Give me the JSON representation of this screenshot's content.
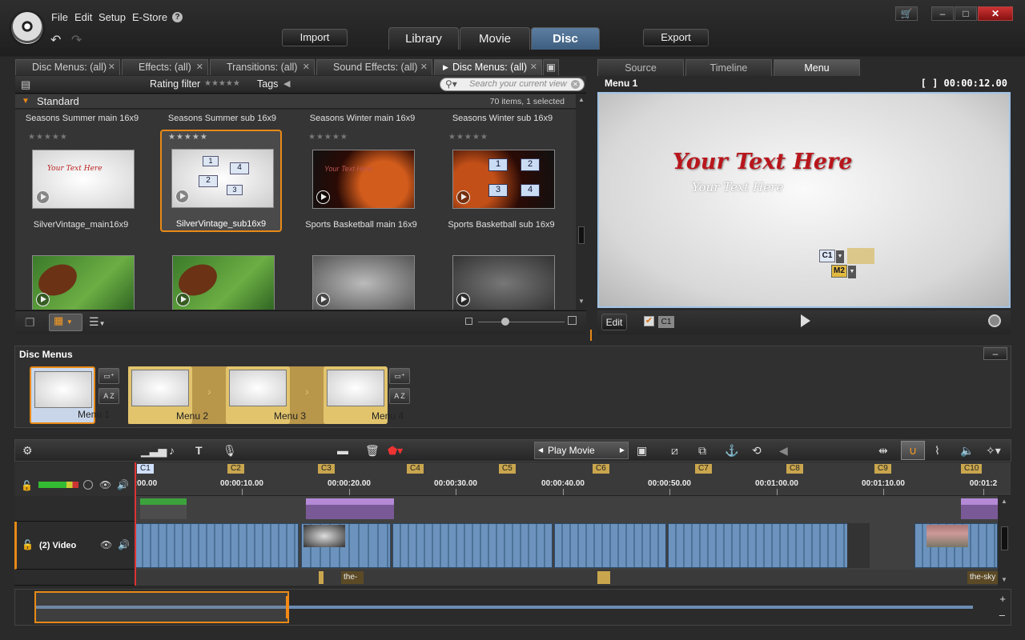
{
  "menubar": {
    "file": "File",
    "edit": "Edit",
    "setup": "Setup",
    "estore": "E-Store",
    "help": "?"
  },
  "header": {
    "import": "Import",
    "export": "Export",
    "tabs": [
      "Library",
      "Movie",
      "Disc"
    ],
    "active_tab": "Disc"
  },
  "window": {
    "cart": "🛒",
    "minimize": "–",
    "maximize": "□",
    "close": "✕"
  },
  "library": {
    "tabs": [
      {
        "label": "Disc Menus: (all)"
      },
      {
        "label": "Effects: (all)"
      },
      {
        "label": "Transitions: (all)"
      },
      {
        "label": "Sound Effects: (all)"
      },
      {
        "label": "Disc Menus: (all)"
      }
    ],
    "rating_filter": "Rating filter",
    "stars": "★★★★★",
    "tags": "Tags",
    "search_placeholder": "Search your current view",
    "group": "Standard",
    "count": "70 items, 1 selected",
    "items": [
      {
        "name": "Seasons Summer main 16x9",
        "stars": "★★★★★"
      },
      {
        "name": "Seasons Summer sub 16x9",
        "stars": "★★★★★"
      },
      {
        "name": "Seasons Winter main 16x9",
        "stars": "★★★★★"
      },
      {
        "name": "Seasons Winter sub 16x9",
        "stars": "★★★★★"
      },
      {
        "name": "SilverVintage_main16x9",
        "stars": "★★★★★"
      },
      {
        "name": "SilverVintage_sub16x9",
        "stars": "★★★★★"
      },
      {
        "name": "Sports Basketball main 16x9",
        "stars": "★★★★★"
      },
      {
        "name": "Sports Basketball sub 16x9",
        "stars": "★★★★★"
      }
    ],
    "thumb_text": {
      "your_text_here": "Your Text Here",
      "numbers": [
        "1",
        "2",
        "3",
        "4"
      ]
    }
  },
  "preview": {
    "tabs": [
      "Source",
      "Timeline",
      "Menu"
    ],
    "active_tab": "Menu",
    "title": "Menu 1",
    "timecode": "[ ] 00:00:12.00",
    "text_main": "Your Text Here",
    "text_sub": "Your Text Here",
    "btn_c1": "C1",
    "btn_m2": "M2",
    "edit": "Edit",
    "c1": "C1"
  },
  "disc_menus": {
    "title": "Disc Menus",
    "collapse": "–",
    "menus": [
      "Menu 1",
      "Menu 2",
      "Menu 3",
      "Menu 4"
    ],
    "az": "A Z"
  },
  "timeline": {
    "play_movie": "Play Movie",
    "chapters": [
      "C1",
      "C2",
      "C3",
      "C4",
      "C5",
      "C6",
      "C7",
      "C8",
      "C9",
      "C10"
    ],
    "timecodes": [
      ":00.00",
      "00:00:10.00",
      "00:00:20.00",
      "00:00:30.00",
      "00:00:40.00",
      "00:00:50.00",
      "00:01:00.00",
      "00:01:10.00",
      "00:01:2"
    ],
    "track_video": "(2) Video",
    "audio_label_1": "the-",
    "audio_label_2": "the-sky"
  }
}
